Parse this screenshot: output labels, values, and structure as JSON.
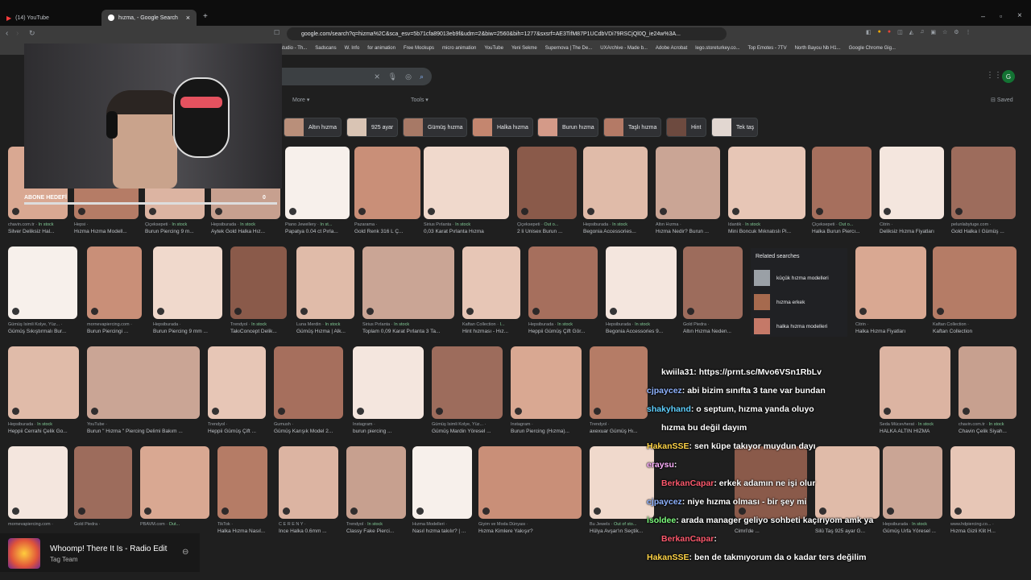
{
  "browser": {
    "tabs": [
      {
        "label": "(14) YouTube",
        "active": false
      },
      {
        "label": "hızma, - Google Search",
        "active": true
      }
    ],
    "new_tab": "+",
    "url": "google.com/search?q=hizma%2C&sca_esv=5b71cfa89013eb9f&udm=2&biw=2560&bih=1277&sxsrf=AE3TifM87P1UCdbVDi79RSCjQl0Q_ie24w%3A...",
    "bookmarks": [
      "studio - Th...",
      "Sadscans",
      "W. Info",
      "for animation",
      "Free Mockups",
      "micro animation",
      "YouTube",
      "Yeni Sekme",
      "Supernova | The De...",
      "UXArchive - Made b...",
      "Adobe Acrobat",
      "lego.storeturkey.co...",
      "Top Emotes - 7TV",
      "North Bayou Nb H1...",
      "Google Chrome Gig..."
    ]
  },
  "search": {
    "filters": [
      "More",
      "Tools"
    ],
    "saved": "Saved",
    "avatar": "G",
    "chips": [
      "Altın hızma",
      "925 ayar",
      "Gümüş hızma",
      "Halka hızma",
      "Burun hızma",
      "Taşlı hızma",
      "Hint",
      "Tek taş"
    ]
  },
  "results": {
    "row1": [
      {
        "src": "chavin.com.tr",
        "stock": "In stock",
        "title": "Silver Deliksiz Hal..."
      },
      {
        "src": "Hepsi",
        "stock": "",
        "title": "Hızma Hızma Modell..."
      },
      {
        "src": "Çiçeksepeti",
        "stock": "In stock",
        "title": "Burun Piercing 9 m..."
      },
      {
        "src": "Hepsiburada",
        "stock": "In stock",
        "title": "Aytek Gold Halka Hız..."
      },
      {
        "src": "Piano Jewellery",
        "stock": "In st...",
        "title": "Papatya 0.04 ct Pırla..."
      },
      {
        "src": "Pazarama",
        "stock": "",
        "title": "Gold Renk 316 L Ç..."
      },
      {
        "src": "Sirius Pırlanta",
        "stock": "In stock",
        "title": "0,03 Karat Pırlanta Hızma"
      },
      {
        "src": "Çiçeksepeti",
        "stock": "Out o...",
        "title": "2 li Unisex Burun ..."
      },
      {
        "src": "Hepsiburada",
        "stock": "In stock",
        "title": "Begonia Accessories..."
      },
      {
        "src": "Altın Hızma",
        "stock": "",
        "title": "Hızma Nedir? Burun ..."
      },
      {
        "src": "Idantik",
        "stock": "In stock",
        "title": "Mini Boncuk Mıknatıslı Pi..."
      },
      {
        "src": "Çiçeksepeti",
        "stock": "Out o...",
        "title": "Halka Burun Piercı..."
      },
      {
        "src": "Citrin",
        "stock": "",
        "title": "Deliksiz Hızma Fiyatları"
      },
      {
        "src": "pelunlabytuge.com",
        "stock": "",
        "title": "Gold Halka I Gümüş ..."
      }
    ],
    "row2": [
      {
        "src": "Gümüş İsimli Kolye, Yüz...",
        "stock": "",
        "title": "Gümüş Sıkıştırmalı Bur..."
      },
      {
        "src": "mornevapiercing.com",
        "stock": "",
        "title": "Burun Piercingi ..."
      },
      {
        "src": "Hepsiburada",
        "stock": "",
        "title": "Burun Piercing 9 mm ..."
      },
      {
        "src": "Trendyol",
        "stock": "In stock",
        "title": "TakıConcept Delik..."
      },
      {
        "src": "Luna Merdin",
        "stock": "In stock",
        "title": "Gümüş Hızma | Alk..."
      },
      {
        "src": "Sirius Pırlanta",
        "stock": "In stock",
        "title": "Toplam 0,09 Karat Pırlanta 3 Ta..."
      },
      {
        "src": "Kaftan Collection",
        "stock": "I...",
        "title": "Hint hızması - Hız..."
      },
      {
        "src": "Hepsiburada",
        "stock": "In stock",
        "title": "Heppii Gümüş Çift Gör..."
      },
      {
        "src": "Hepsiburada",
        "stock": "In stock",
        "title": "Begonia Accessories 9..."
      },
      {
        "src": "Gold Piedra",
        "stock": "",
        "title": "Altın Hızma Neden..."
      },
      {
        "src": "Citrin",
        "stock": "",
        "title": "Halka Hızma Fiyatları"
      },
      {
        "src": "Kaftan Collection",
        "stock": "",
        "title": "Kaftan Collection"
      }
    ],
    "related": {
      "heading": "Related searches",
      "items": [
        "küçük hızma modelleri",
        "hızma erkek",
        "halka hızma modelleri"
      ]
    },
    "row3": [
      {
        "src": "Hepsiburada",
        "stock": "In stock",
        "title": "Heppii Cerrahi Çelik Go..."
      },
      {
        "src": "YouTube",
        "stock": "",
        "title": "Burun \" Hızma \" Piercing Delimi Bakım ..."
      },
      {
        "src": "Trendyol",
        "stock": "",
        "title": "Heppii Gümüş Çift ..."
      },
      {
        "src": "Gumush",
        "stock": "",
        "title": "Gümüş Karışık Model 2..."
      },
      {
        "src": "Instagram",
        "stock": "",
        "title": "burun piercing ..."
      },
      {
        "src": "Gümüş İsimli Kolye, Yüz...",
        "stock": "",
        "title": "Gümüş Mardin Yöresel ..."
      },
      {
        "src": "Instagram",
        "stock": "",
        "title": "Burun Piercing (Hızma)..."
      },
      {
        "src": "Trendyol",
        "stock": "",
        "title": "axexuar Gümüş Hı..."
      },
      {
        "src": "Seda Mücevherat",
        "stock": "In stock",
        "title": "HALKA ALTIN HIZMA"
      },
      {
        "src": "chavin.com.tr",
        "stock": "In stock",
        "title": "Chavin Çelik Siyah..."
      }
    ],
    "row4": [
      {
        "src": "mornevapiercing.com",
        "stock": "",
        "title": ""
      },
      {
        "src": "Gold Piedra",
        "stock": "",
        "title": ""
      },
      {
        "src": "PBAVM.com",
        "stock": "Out...",
        "title": ""
      },
      {
        "src": "TikTok",
        "stock": "",
        "title": "Halka Hızma Nasıl..."
      },
      {
        "src": "C E R E N Y",
        "stock": "",
        "title": "İnce Halka 0.6mm ..."
      },
      {
        "src": "Trendyol",
        "stock": "In stock",
        "title": "Classy Fake Pierci..."
      },
      {
        "src": "Hızma Modelleri",
        "stock": "",
        "title": "Nasıl hızma takılır? | ..."
      },
      {
        "src": "Giyim ve Moda Dünyası",
        "stock": "",
        "title": "Hızma Kimlere Yakışır?"
      },
      {
        "src": "Bu Jewels",
        "stock": "Out of sto...",
        "title": "Hülya Avşar'ın Seçtik..."
      },
      {
        "src": "",
        "stock": "",
        "title": "Cimri'de ..."
      },
      {
        "src": "",
        "stock": "",
        "title": "Silü Taş 925 ayar G..."
      },
      {
        "src": "Hepsiburada",
        "stock": "In stock",
        "title": "Gümüş Urfa Yöresel ..."
      },
      {
        "src": "www.hdpiercing.co...",
        "stock": "",
        "title": "Hızma Gizli Klit H..."
      }
    ]
  },
  "stream": {
    "goal_label": "ABONE HEDEFİ",
    "goal_count": "0",
    "chat": [
      {
        "user": "kwiila31",
        "color": "#ffffff",
        "text": ": https://prnt.sc/Mvo6VSn1RbLv"
      },
      {
        "user": "cjpaycez",
        "color": "#8fb3ff",
        "text": ": abi bizim sınıfta 3 tane var bundan"
      },
      {
        "user": "shakyhand",
        "color": "#5fd0ff",
        "text": ": o septum, hızma yanda oluyo"
      },
      {
        "user": "",
        "color": "#ffffff",
        "text": "hızma bu değil dayım"
      },
      {
        "user": "HakanSSE",
        "color": "#ffd447",
        "text": ": sen küpe takıyor muydun dayı"
      },
      {
        "user": "eraysu",
        "color": "#ffb0ff",
        "text": ":"
      },
      {
        "user": "BerkanCapar",
        "color": "#ff5a6e",
        "text": ": erkek adamın ne işi olur"
      },
      {
        "user": "cjpaycez",
        "color": "#8fb3ff",
        "text": ": niye hızma olması - bir şey mi"
      },
      {
        "user": "isoldee",
        "color": "#7dff7d",
        "text": ": arada manager geliyo sohbeti kaçırıyom amk ya"
      },
      {
        "user": "BerkanCapar",
        "color": "#ff5a6e",
        "text": ":"
      },
      {
        "user": "HakanSSE",
        "color": "#ffd447",
        "text": ": ben de takmıyorum da o kadar ters değilim"
      }
    ],
    "chat_prefix": "BerkanCapar",
    "now_playing": {
      "title": "Whoomp! There It Is - Radio Edit",
      "artist": "Tag Team"
    }
  }
}
